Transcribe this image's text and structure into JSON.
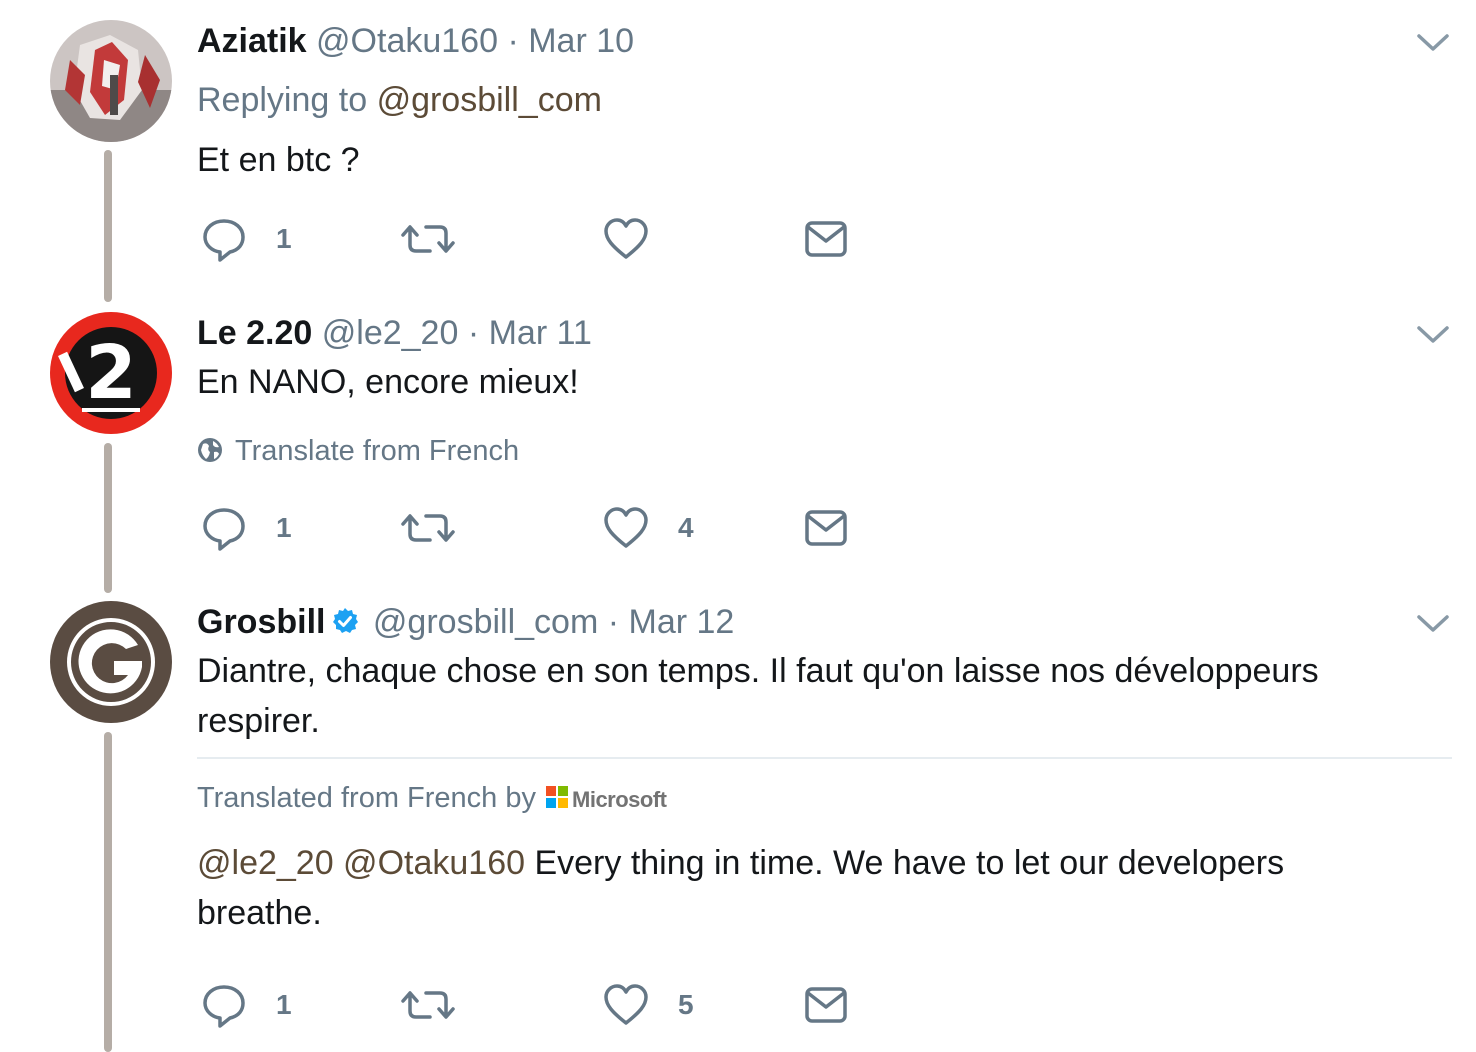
{
  "tweets": [
    {
      "name": "Aziatik",
      "handle": "@Otaku160",
      "date": "· Mar 10",
      "replying_prefix": "Replying to",
      "replying_to": "@grosbill_com",
      "text": "Et en btc ?",
      "actions": {
        "replies": "1",
        "retweets": "",
        "likes": ""
      }
    },
    {
      "name": "Le 2.20",
      "handle": "@le2_20",
      "date": "· Mar 11",
      "text": "En NANO, encore mieux!",
      "translate_label": "Translate from French",
      "actions": {
        "replies": "1",
        "retweets": "",
        "likes": "4"
      }
    },
    {
      "name": "Grosbill",
      "verified": true,
      "handle": "@grosbill_com",
      "date": "· Mar 12",
      "text": "Diantre, chaque chose en son temps. Il faut qu'on laisse nos développeurs respirer.",
      "translated_by_label": "Translated from French by",
      "translator": "Microsoft",
      "translation_mentions": "@le2_20 @Otaku160",
      "translation_text": " Every thing in time. We have to let our developers breathe.",
      "actions": {
        "replies": "1",
        "retweets": "",
        "likes": "5"
      }
    }
  ],
  "icons": {
    "reply": "speech-bubble-icon",
    "retweet": "retweet-icon",
    "like": "heart-icon",
    "dm": "envelope-icon",
    "caret": "chevron-down-icon",
    "globe": "globe-icon"
  },
  "colors": {
    "thread_line": "#b5ada6",
    "link": "#5c4b37",
    "muted": "#657786",
    "verified": "#1da1f2"
  }
}
